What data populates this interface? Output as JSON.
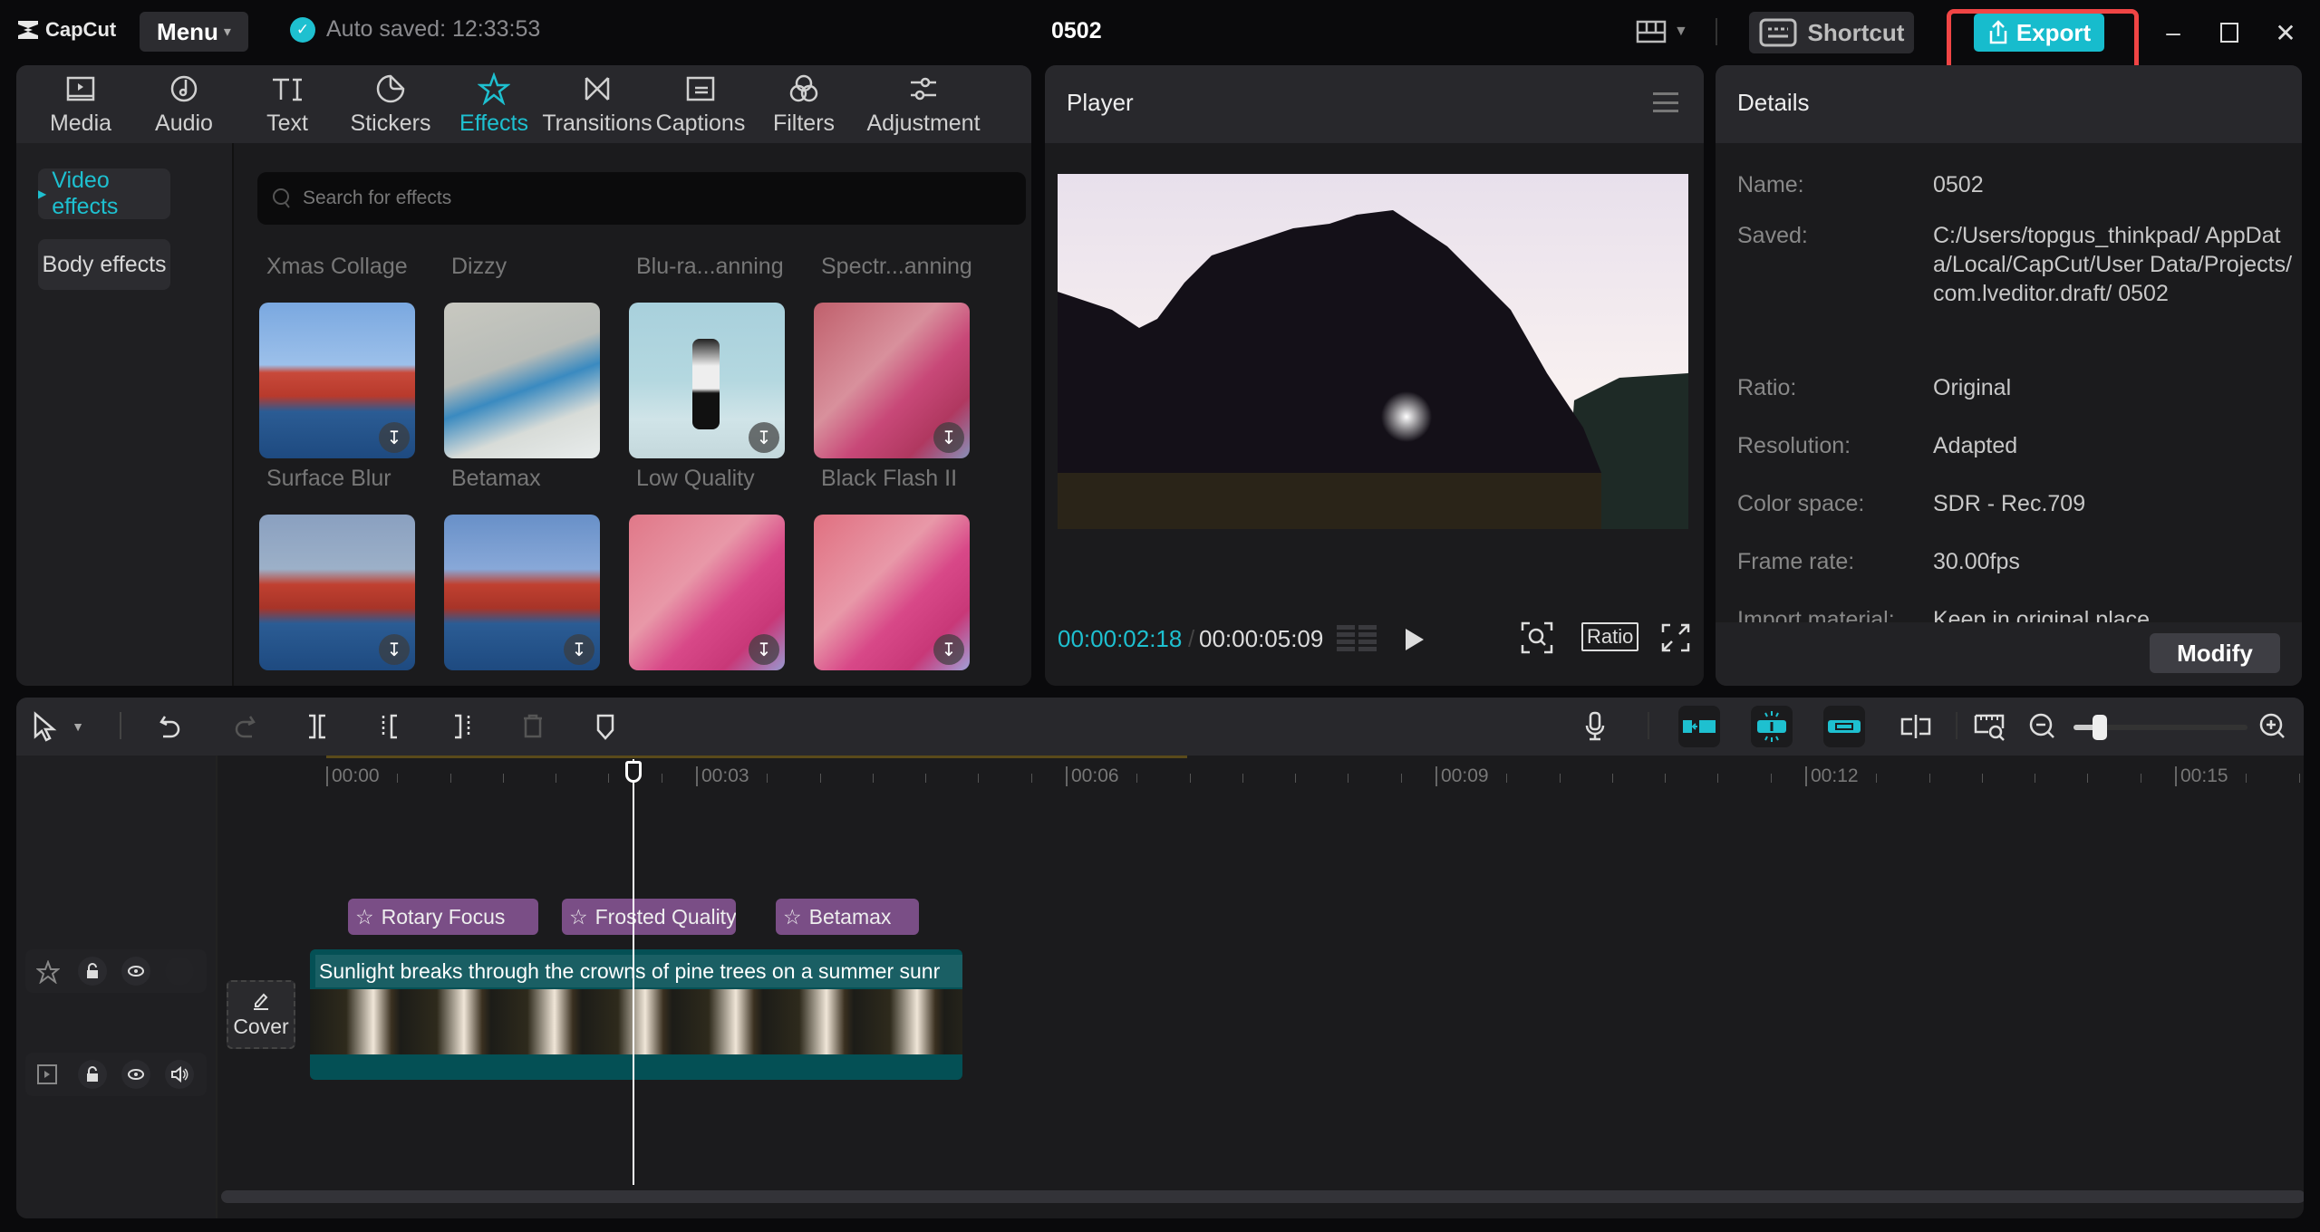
{
  "app": {
    "name": "CapCut",
    "menu_label": "Menu",
    "autosave": "Auto saved: 12:33:53",
    "project_title": "0502"
  },
  "topbar": {
    "shortcut_label": "Shortcut",
    "export_label": "Export",
    "accent": "#17bccd",
    "highlight": "#f04545"
  },
  "tabs": [
    {
      "label": "Media",
      "icon": "media-icon"
    },
    {
      "label": "Audio",
      "icon": "audio-icon"
    },
    {
      "label": "Text",
      "icon": "text-icon"
    },
    {
      "label": "Stickers",
      "icon": "sticker-icon"
    },
    {
      "label": "Effects",
      "icon": "effects-icon",
      "active": true
    },
    {
      "label": "Transitions",
      "icon": "transitions-icon"
    },
    {
      "label": "Captions",
      "icon": "captions-icon"
    },
    {
      "label": "Filters",
      "icon": "filters-icon"
    },
    {
      "label": "Adjustment",
      "icon": "adjustment-icon"
    }
  ],
  "effects_sidebar": [
    {
      "label": "Video effects",
      "active": true
    },
    {
      "label": "Body effects"
    }
  ],
  "search": {
    "placeholder": "Search for effects"
  },
  "effects_header_row": [
    "Xmas Collage",
    "Dizzy",
    "Blu-ra...anning",
    "Spectr...anning"
  ],
  "effects_row1": [
    "Surface Blur",
    "Betamax",
    "Low Quality",
    "Black Flash II"
  ],
  "player": {
    "title": "Player",
    "current_time": "00:00:02:18",
    "separator": "/",
    "total_time": "00:00:05:09",
    "ratio_label": "Ratio"
  },
  "details": {
    "title": "Details",
    "rows": [
      {
        "key": "Name:",
        "value": "0502"
      },
      {
        "key": "Saved:",
        "value": "C:/Users/topgus_thinkpad/ AppData/Local/CapCut/User Data/Projects/com.lveditor.draft/ 0502"
      },
      {
        "key": "Ratio:",
        "value": "Original"
      },
      {
        "key": "Resolution:",
        "value": "Adapted"
      },
      {
        "key": "Color space:",
        "value": "SDR - Rec.709"
      },
      {
        "key": "Frame rate:",
        "value": "30.00fps"
      },
      {
        "key": "Import material:",
        "value": "Keep in original place"
      }
    ],
    "modify_label": "Modify"
  },
  "timeline": {
    "ruler": [
      "00:00",
      "00:03",
      "00:06",
      "00:09",
      "00:12",
      "00:15"
    ],
    "effect_clips": [
      "Rotary Focus",
      "Frosted Quality",
      "Betamax"
    ],
    "video_clip_title": "Sunlight breaks through the crowns of pine trees on a summer sunr",
    "cover_label": "Cover",
    "zoom_level": 0.15
  }
}
